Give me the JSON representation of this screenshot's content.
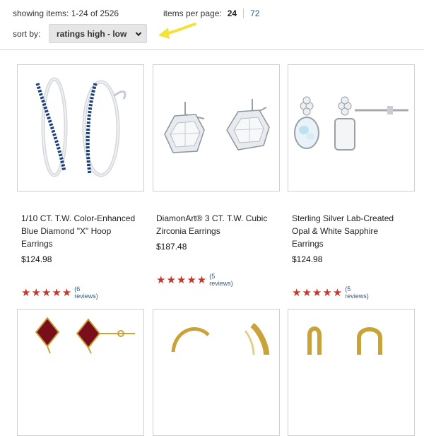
{
  "toolbar": {
    "showing_text": "showing items: 1-24 of 2526",
    "per_page_label": "items per page:",
    "per_page_options": [
      "24",
      "72"
    ],
    "per_page_selected": "24",
    "sort_label": "sort by:",
    "sort_value": "ratings high - low"
  },
  "products": [
    {
      "title": "1/10 CT. T.W. Color-Enhanced Blue Diamond \"X\" Hoop Earrings",
      "price": "$124.98",
      "stars": "★★★★★",
      "reviews": "(6 reviews)"
    },
    {
      "title": "DiamonArt® 3 CT. T.W. Cubic Zirconia Earrings",
      "price": "$187.48",
      "stars": "★★★★★",
      "reviews": "(5 reviews)"
    },
    {
      "title": "Sterling Silver Lab-Created Opal & White Sapphire Earrings",
      "price": "$124.98",
      "stars": "★★★★★",
      "reviews": "(5 reviews)"
    }
  ],
  "colors": {
    "star": "#c0392b",
    "link": "#2a5a8a",
    "arrow": "#f2e23a"
  }
}
